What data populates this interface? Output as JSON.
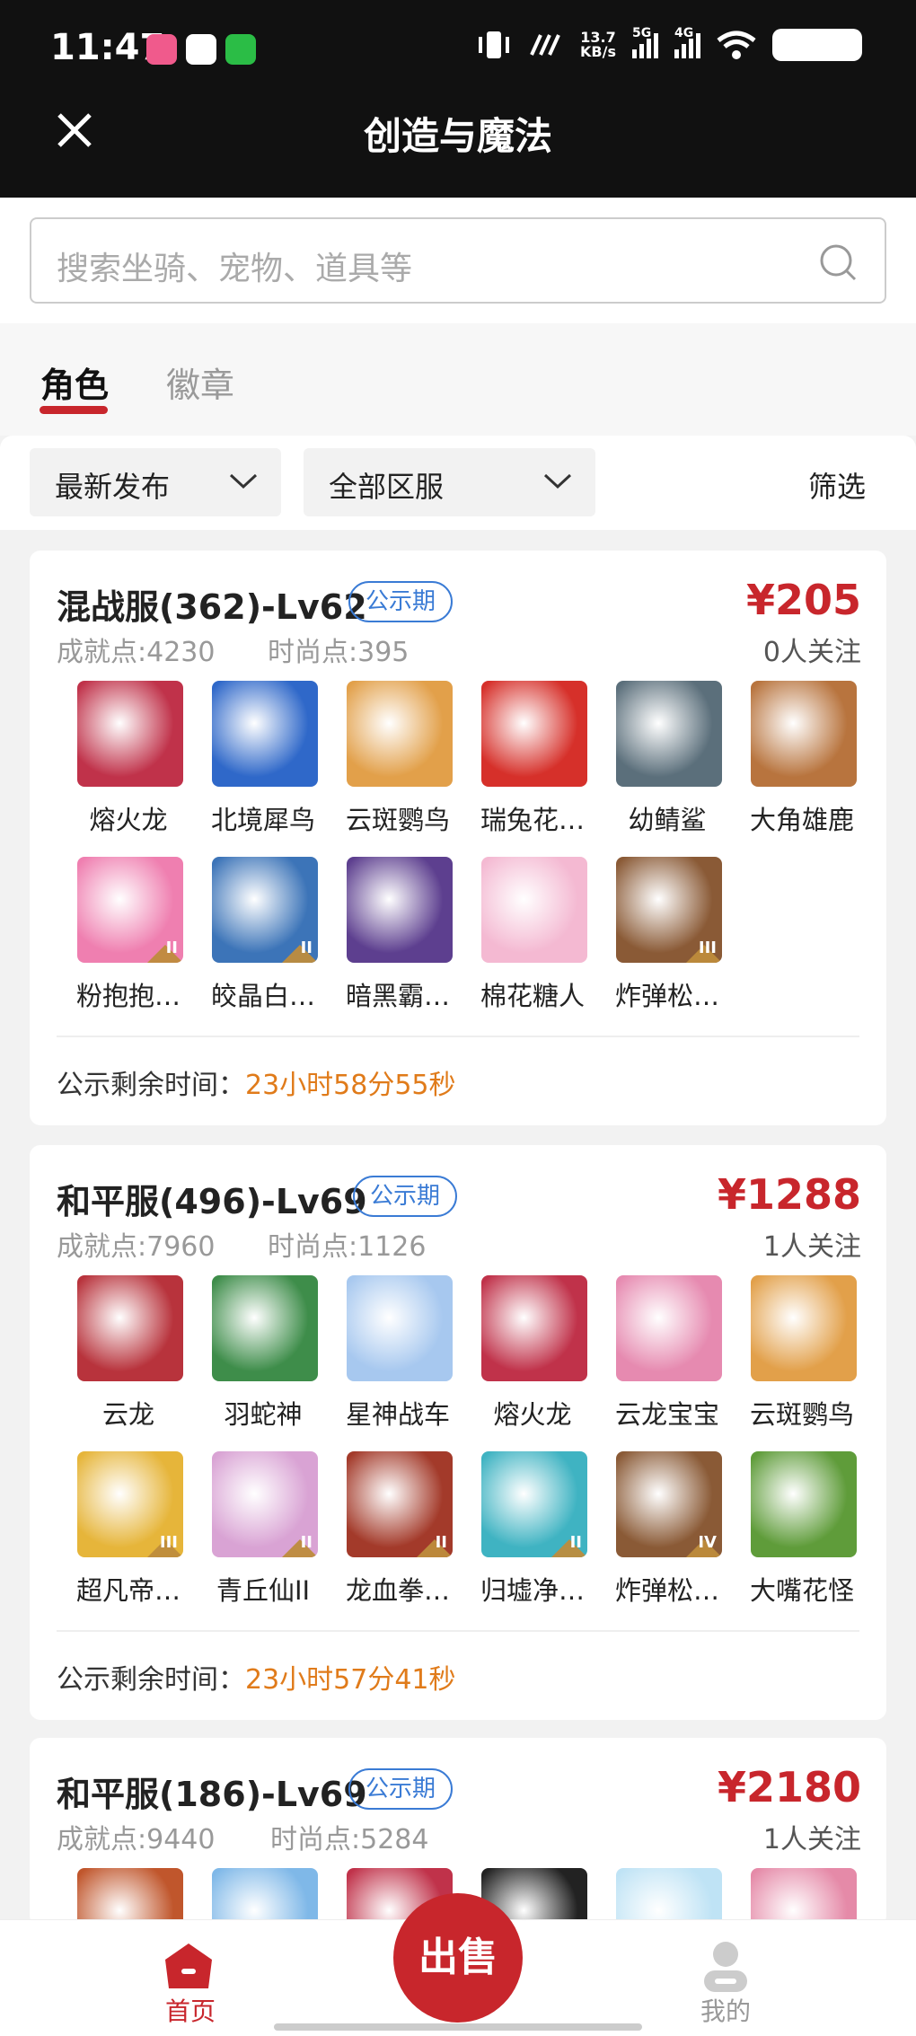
{
  "status_bar": {
    "time": "11:47",
    "speed_value": "13.7",
    "speed_unit": "KB/s",
    "net1": "5G",
    "net2": "4G"
  },
  "header": {
    "title": "创造与魔法"
  },
  "search": {
    "placeholder": "搜索坐骑、宠物、道具等"
  },
  "tabs": [
    {
      "label": "角色"
    },
    {
      "label": "徽章"
    }
  ],
  "filters": {
    "sort": "最新发布",
    "server": "全部区服",
    "filter": "筛选"
  },
  "labels": {
    "achievement": "成就点:",
    "fashion": "时尚点:",
    "remain": "公示剩余时间："
  },
  "cards": [
    {
      "title": "混战服(362)-Lv62",
      "badge": "公示期",
      "price": "¥205",
      "follow": "0人关注",
      "achievement": "4230",
      "fashion": "395",
      "remain_time": "23小时58分55秒",
      "items": [
        {
          "name": "熔火龙",
          "color": "#c0324a",
          "tier": ""
        },
        {
          "name": "北境犀鸟",
          "color": "#2f68c9",
          "tier": ""
        },
        {
          "name": "云斑鹦鸟",
          "color": "#e2a04a",
          "tier": ""
        },
        {
          "name": "瑞兔花…",
          "color": "#d6302a",
          "tier": ""
        },
        {
          "name": "幼鲭鲨",
          "color": "#5b6f7b",
          "tier": ""
        },
        {
          "name": "大角雄鹿",
          "color": "#b8743e",
          "tier": ""
        },
        {
          "name": "粉抱抱…",
          "color": "#ef7fb0",
          "tier": "II"
        },
        {
          "name": "皎晶白…",
          "color": "#3c74b8",
          "tier": "II"
        },
        {
          "name": "暗黑霸…",
          "color": "#5d3f8f",
          "tier": ""
        },
        {
          "name": "棉花糖人",
          "color": "#f4b9d2",
          "tier": ""
        },
        {
          "name": "炸弹松…",
          "color": "#8a5a36",
          "tier": "III"
        }
      ]
    },
    {
      "title": "和平服(496)-Lv69",
      "badge": "公示期",
      "price": "¥1288",
      "follow": "1人关注",
      "achievement": "7960",
      "fashion": "1126",
      "remain_time": "23小时57分41秒",
      "items": [
        {
          "name": "云龙",
          "color": "#b8333c",
          "tier": ""
        },
        {
          "name": "羽蛇神",
          "color": "#3e8d4a",
          "tier": ""
        },
        {
          "name": "星神战车",
          "color": "#a7c8ef",
          "tier": ""
        },
        {
          "name": "熔火龙",
          "color": "#c0324a",
          "tier": ""
        },
        {
          "name": "云龙宝宝",
          "color": "#e68ab0",
          "tier": ""
        },
        {
          "name": "云斑鹦鸟",
          "color": "#e2a04a",
          "tier": ""
        },
        {
          "name": "超凡帝…",
          "color": "#e6b53a",
          "tier": "III"
        },
        {
          "name": "青丘仙II",
          "color": "#d9a3d4",
          "tier": "II"
        },
        {
          "name": "龙血拳…",
          "color": "#a33a2a",
          "tier": "II"
        },
        {
          "name": "归墟净…",
          "color": "#3fb3c2",
          "tier": "II"
        },
        {
          "name": "炸弹松…",
          "color": "#8a5a36",
          "tier": "IV"
        },
        {
          "name": "大嘴花怪",
          "color": "#5f9c3a",
          "tier": ""
        }
      ]
    },
    {
      "title": "和平服(186)-Lv69",
      "badge": "公示期",
      "price": "¥2180",
      "follow": "1人关注",
      "achievement": "9440",
      "fashion": "5284",
      "items": [
        {
          "color": "#c0562c"
        },
        {
          "color": "#7fb8e8"
        },
        {
          "color": "#c0324a"
        },
        {
          "color": "#222222"
        },
        {
          "color": "#bfe3f5"
        },
        {
          "color": "#e58aa8"
        }
      ]
    }
  ],
  "bottom_nav": {
    "home": "首页",
    "sell": "出售",
    "me": "我的"
  },
  "colors": {
    "brand_red": "#c8262c",
    "badge_blue": "#3a7bd5",
    "countdown_orange": "#e07b1a"
  }
}
